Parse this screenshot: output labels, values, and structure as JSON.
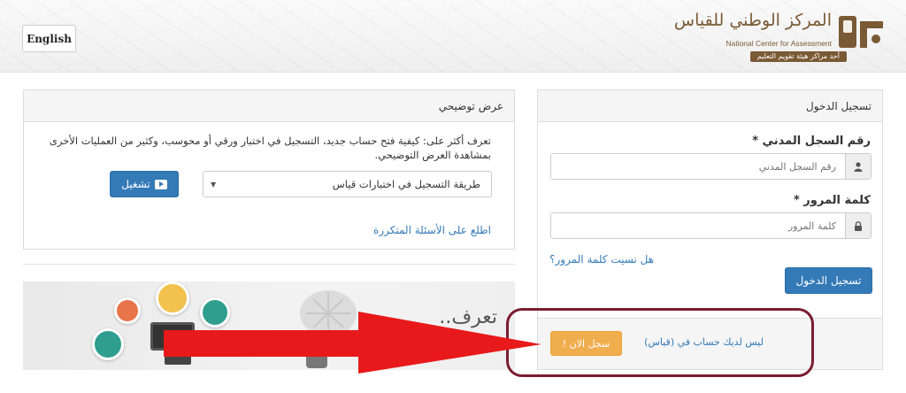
{
  "header": {
    "language_button": "English",
    "logo": {
      "arabic_name": "المركز الوطني للقياس",
      "english_name": "National Center for Assessment",
      "tagline": "أحد مراكز هيئة تقويم التعليم"
    }
  },
  "login": {
    "title": "تسجيل الدخول",
    "id_label": "رقم السجل المدني *",
    "id_placeholder": "رقم السجل المدني",
    "password_label": "كلمة المرور *",
    "password_placeholder": "كلمة المرور",
    "forgot_password": "هل نسيت كلمة المرور؟",
    "login_button": "تسجيل الدخول",
    "no_account_text": "ليس لديك حساب في (قياس)",
    "register_button": "سجل الان !"
  },
  "demo": {
    "title": "عرض توضيحي",
    "description": "تعرف أكثر على: كيفية فتح حساب جديد، التسجيل في اختبار ورقي أو محوسب، وكثير من العمليات الأخرى بمشاهدة العرض التوضيحي.",
    "select_value": "طريقة التسجيل في اختبارات قياس",
    "play_button": "تشغيل",
    "faq_link": "اطلع على الأسئلة المتكررة"
  },
  "banner": {
    "text": "تعرف.."
  },
  "colors": {
    "primary": "#337ab7",
    "warning": "#f0ad4e",
    "highlight_border": "#7a1d2e",
    "arrow": "#e8191a"
  }
}
